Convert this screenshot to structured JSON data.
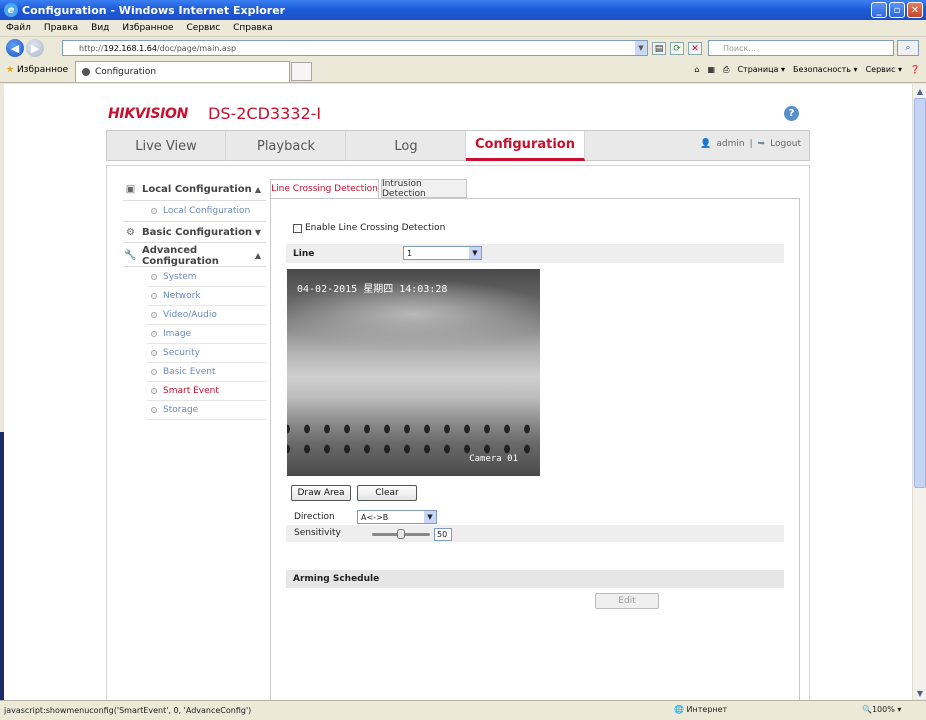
{
  "window": {
    "title": "Configuration - Windows Internet Explorer"
  },
  "menu": [
    "Файл",
    "Правка",
    "Вид",
    "Избранное",
    "Сервис",
    "Справка"
  ],
  "address": {
    "prefix": "http://",
    "host": "192.168.1.64",
    "path": "/doc/page/main.asp"
  },
  "search": {
    "placeholder": "Поиск..."
  },
  "favorites": {
    "label": "Избранное"
  },
  "browser_tab": {
    "title": "Configuration"
  },
  "commands": [
    "Страница ▾",
    "Безопасность ▾",
    "Сервис ▾"
  ],
  "brand": {
    "logo": "HIKVISION",
    "model": "DS-2CD3332-I",
    "help": "?"
  },
  "topnav": {
    "items": [
      "Live View",
      "Playback",
      "Log",
      "Configuration"
    ],
    "active": "Configuration"
  },
  "user": {
    "name": "admin",
    "separator": "|",
    "logout": "Logout"
  },
  "sidebar": {
    "local": {
      "title": "Local Configuration",
      "items": [
        "Local Configuration"
      ]
    },
    "basic": {
      "title": "Basic Configuration"
    },
    "advanced": {
      "title": "Advanced Configuration",
      "items": [
        "System",
        "Network",
        "Video/Audio",
        "Image",
        "Security",
        "Basic Event",
        "Smart Event",
        "Storage"
      ],
      "active": "Smart Event"
    }
  },
  "tabs": [
    "Line Crossing Detection",
    "Intrusion Detection"
  ],
  "form": {
    "enable_label": "Enable Line Crossing Detection",
    "enable_checked": false,
    "line_label": "Line",
    "line_value": "1",
    "osd_time": "04-02-2015 星期四 14:03:28",
    "osd_camera": "Camera 01",
    "draw_area": "Draw Area",
    "clear": "Clear",
    "direction_label": "Direction",
    "direction_value": "A<->B",
    "sensitivity_label": "Sensitivity",
    "sensitivity_value": "50",
    "sensitivity_level": 0.5,
    "arming_schedule": "Arming Schedule",
    "edit": "Edit"
  },
  "status": {
    "message": "javascript:showmenuconfig('SmartEvent', 0, 'AdvanceConfig')",
    "zone": "Интернет",
    "zoom": "100%"
  },
  "colors": {
    "brand_red": "#c8102e",
    "link_blue": "#6a8bb8",
    "xp_blue": "#1f5bd8"
  }
}
